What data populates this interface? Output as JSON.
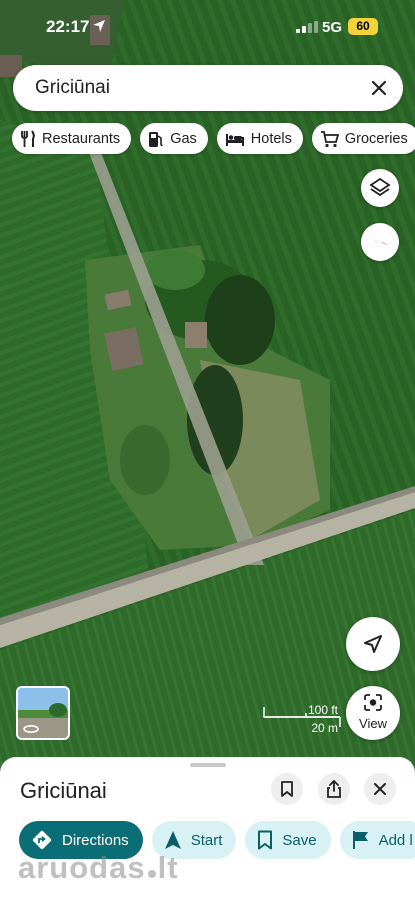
{
  "status_bar": {
    "time": "22:17",
    "network": "5G",
    "battery": "60"
  },
  "search": {
    "query": "Griciūnai"
  },
  "categories": [
    {
      "label": "Restaurants",
      "icon": "fork-knife-icon"
    },
    {
      "label": "Gas",
      "icon": "gas-pump-icon"
    },
    {
      "label": "Hotels",
      "icon": "bed-icon"
    },
    {
      "label": "Groceries",
      "icon": "cart-icon"
    }
  ],
  "map_controls": {
    "view_label": "View"
  },
  "scale": {
    "imperial": "100 ft",
    "metric": "20 m"
  },
  "place": {
    "title": "Griciūnai"
  },
  "actions": [
    {
      "label": "Directions",
      "icon": "directions-icon",
      "primary": true
    },
    {
      "label": "Start",
      "icon": "navigation-arrow-icon",
      "primary": false
    },
    {
      "label": "Save",
      "icon": "bookmark-icon",
      "primary": false
    },
    {
      "label": "Add l",
      "icon": "flag-icon",
      "primary": false
    }
  ],
  "watermark": {
    "text_left": "aruodas",
    "text_right": "lt"
  },
  "colors": {
    "accent": "#0b6e77",
    "accent_light": "#d7f1f4",
    "battery": "#f2d33a"
  }
}
